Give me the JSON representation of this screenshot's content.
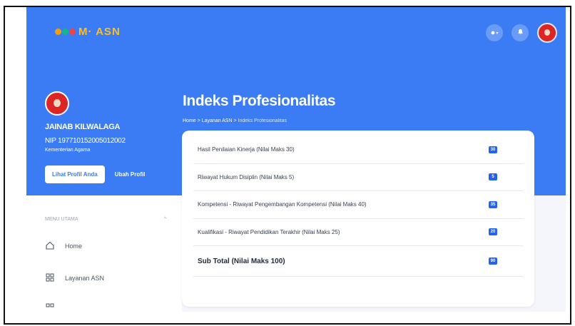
{
  "header": {
    "logo_text": "M· ASN",
    "colors": {
      "primary": "#3b7cf5",
      "badge": "#2563eb",
      "accent": "#fbbf24"
    }
  },
  "profile": {
    "name": "JAINAB KILWALAGA",
    "nip": "NIP 197710152005012002",
    "org": "Kementerian Agama",
    "view_profile_label": "Lihat Profil Anda",
    "edit_profile_label": "Ubah Profil"
  },
  "page": {
    "title": "Indeks Profesionalitas",
    "breadcrumb": {
      "home": "Home",
      "sep1": ">",
      "section": "Layanan ASN",
      "sep2": ">",
      "current": "Indeks Profesionalitas"
    }
  },
  "sidebar": {
    "menu_title": "MENU UTAMA",
    "items": [
      {
        "label": "Home",
        "icon": "home-icon"
      },
      {
        "label": "Layanan ASN",
        "icon": "grid-icon"
      }
    ]
  },
  "scores": [
    {
      "label": "Hasil Penilaian Kinerja (Nilai Maks 30)",
      "value": "30"
    },
    {
      "label": "Riwayat Hukum Disiplin (Nilai Maks 5)",
      "value": "5"
    },
    {
      "label": "Kompetensi - Riwayat Pengembangan Kompetensi (Nilai Maks 40)",
      "value": "35"
    },
    {
      "label": "Kualifikasi - Riwayat Pendidikan Terakhir (Nilai Maks 25)",
      "value": "20"
    }
  ],
  "subtotal": {
    "label": "Sub Total (Nilai Maks 100)",
    "value": "90"
  }
}
